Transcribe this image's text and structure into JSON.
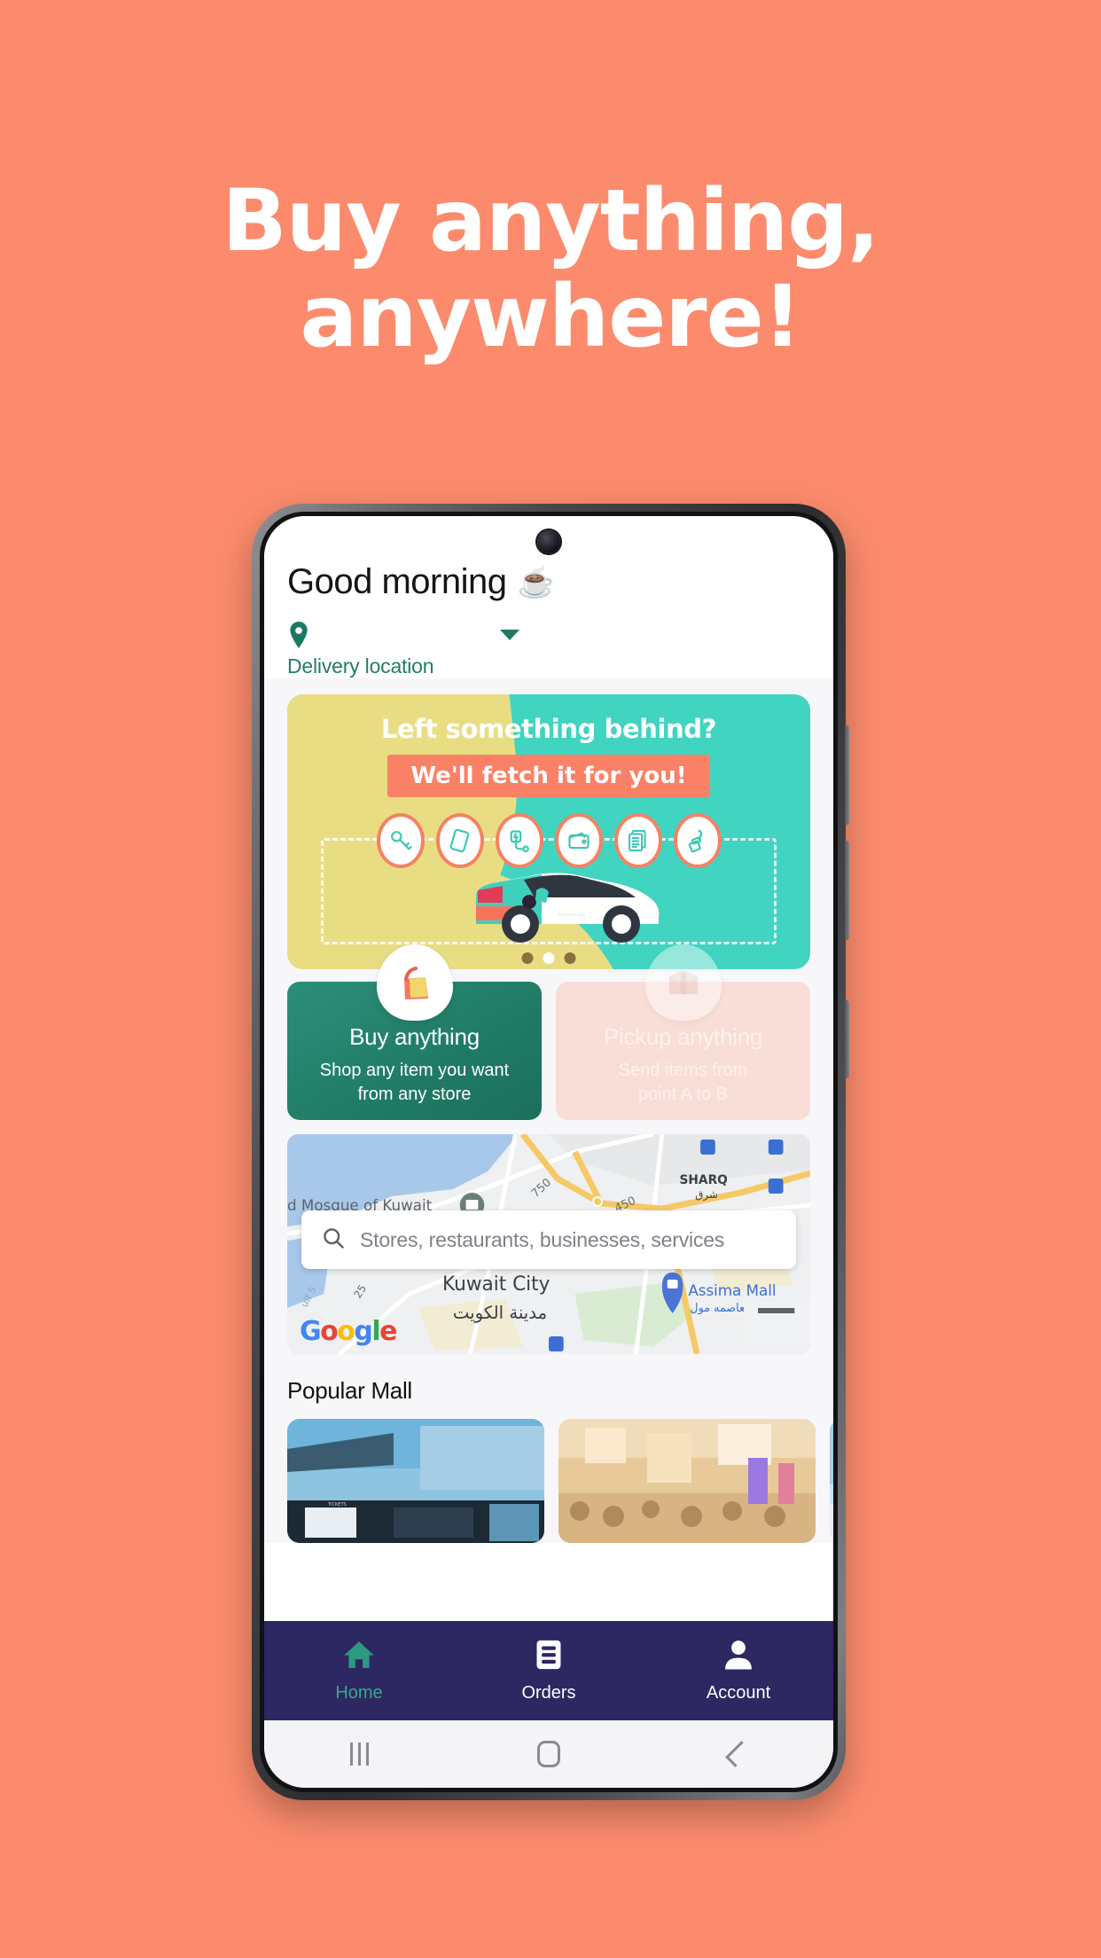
{
  "page": {
    "background_color": "#fb8b6c",
    "headline_line1": "Buy anything,",
    "headline_line2": "anywhere!"
  },
  "app": {
    "header": {
      "greeting": "Good morning",
      "greeting_emoji": "☕",
      "location_icon": "location-pin-icon",
      "location_label": "Delivery location",
      "dropdown_icon": "chevron-down-icon"
    },
    "promo_banner": {
      "title": "Left something behind?",
      "subtitle": "We'll fetch it for you!",
      "icons": [
        "key-icon",
        "phone-icon",
        "charger-icon",
        "wallet-icon",
        "documents-icon",
        "lipstick-icon"
      ],
      "car_brand": "mashkor",
      "carousel_dots": 3,
      "active_dot": 2,
      "teal_color": "#41d4c0",
      "yellow_color": "#e9dd84",
      "accent_color": "#fb8166"
    },
    "action_cards": [
      {
        "id": "buy-anything",
        "title": "Buy anything",
        "description_line1": "Shop any item you want",
        "description_line2": "from any store",
        "icon": "shopping-bag-icon",
        "state": "active",
        "color": "#1f7b64"
      },
      {
        "id": "pickup-anything",
        "title": "Pickup anything",
        "description_line1": "Send items from",
        "description_line2": "point A to B",
        "icon": "package-box-icon",
        "state": "disabled",
        "color": "#f9ddd7"
      }
    ],
    "map": {
      "search_icon": "search-icon",
      "search_placeholder": "Stores, restaurants, businesses, services",
      "search_value": "",
      "provider_logo": "Google",
      "city_label_en": "Kuwait City",
      "city_label_ar": "مدينة الكويت",
      "district_en": "SHARQ",
      "district_ar": "شرق",
      "poi_mosque": "d Mosque of Kuwait",
      "poi_mall_en": "Assima Mall",
      "poi_mall_ar": "العاصمه مول",
      "road_labels": [
        "750",
        "450",
        "25"
      ],
      "water_label": "ulf S"
    },
    "popular_mall": {
      "section_title": "Popular Mall",
      "cards": [
        {
          "id": "mall-card-1",
          "alt": "mall-exterior-photo"
        },
        {
          "id": "mall-card-2",
          "alt": "mall-interior-photo"
        },
        {
          "id": "mall-card-3",
          "alt": "mall-photo-partial"
        }
      ]
    },
    "bottom_nav": {
      "items": [
        {
          "label": "Home",
          "icon": "home-icon",
          "active": true
        },
        {
          "label": "Orders",
          "icon": "orders-icon",
          "active": false
        },
        {
          "label": "Account",
          "icon": "account-icon",
          "active": false
        }
      ],
      "background_color": "#2d2762",
      "active_color": "#3aa88d"
    },
    "system_nav": {
      "recents_icon": "recents-icon",
      "home_icon": "system-home-icon",
      "back_icon": "back-icon"
    }
  }
}
